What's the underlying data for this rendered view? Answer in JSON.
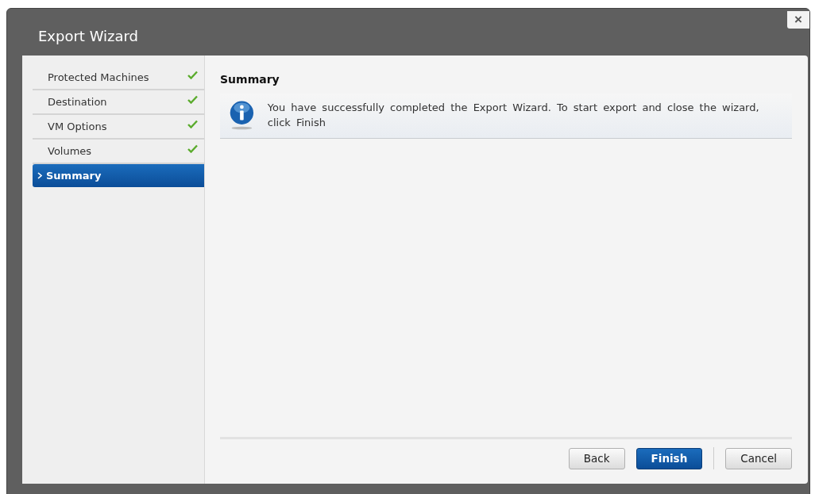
{
  "window": {
    "title": "Export Wizard",
    "close": "×"
  },
  "steps": [
    {
      "label": "Protected Machines",
      "completed": true,
      "selected": false
    },
    {
      "label": "Destination",
      "completed": true,
      "selected": false
    },
    {
      "label": "VM Options",
      "completed": true,
      "selected": false
    },
    {
      "label": "Volumes",
      "completed": true,
      "selected": false
    },
    {
      "label": "Summary",
      "completed": false,
      "selected": true
    }
  ],
  "content": {
    "heading": "Summary",
    "message": "You have successfully completed the Export Wizard. To start export and close the wizard, click Finish"
  },
  "buttons": [
    {
      "label": "Back",
      "kind": "default"
    },
    {
      "label": "Finish",
      "kind": "primary"
    },
    {
      "label": "Cancel",
      "kind": "cancel"
    }
  ]
}
